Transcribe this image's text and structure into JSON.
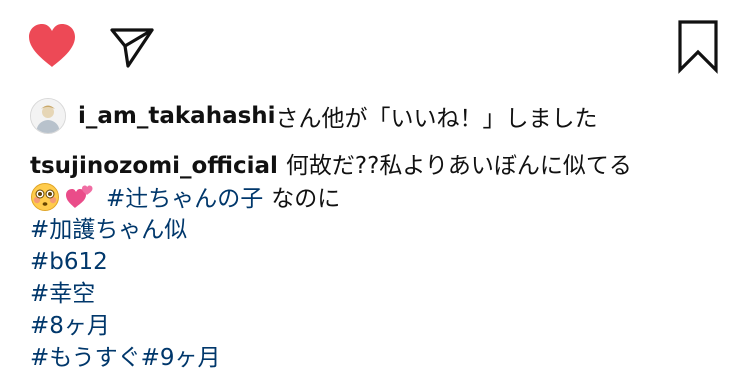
{
  "actions": {
    "like_icon": "heart-filled-icon",
    "like_color": "#ed4956",
    "share_icon": "send-icon",
    "save_icon": "bookmark-icon"
  },
  "likes": {
    "username": "i_am_takahashi",
    "suffix": "さん他が「いいね！」しました"
  },
  "caption": {
    "author": "tsujinozomi_official",
    "line1_text": "何故だ??私よりあいぼんに似てる",
    "emojis": [
      "flushed-face-icon",
      "two-hearts-icon"
    ],
    "line2_hashtag": "#辻ちゃんの子",
    "line2_text": "なのに",
    "hashtags": [
      "#加護ちゃん似",
      "#b612",
      "#幸空",
      "#8ヶ月",
      "#もうすぐ#9ヶ月"
    ]
  },
  "colors": {
    "hashtag": "#00376b",
    "text": "#111111"
  }
}
